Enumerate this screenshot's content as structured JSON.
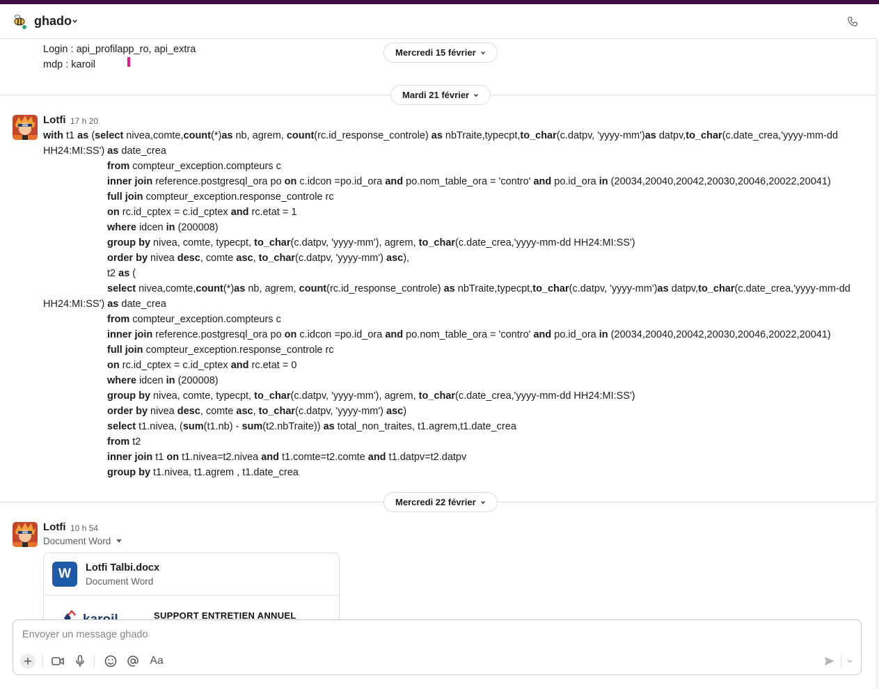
{
  "header": {
    "workspace_name": "ghado"
  },
  "previous_message": {
    "lines": [
      "Login : api_profilapp_ro, api_extra",
      "mdp : karoil"
    ]
  },
  "dates": {
    "d1": "Mercredi 15 février",
    "d2": "Mardi 21 février",
    "d3": "Mercredi 22 février"
  },
  "message1": {
    "author": "Lotfi",
    "time": "17 h 20"
  },
  "message2": {
    "author": "Lotfi",
    "time": "10 h 54",
    "file_subtitle": "Document Word",
    "file": {
      "icon_letter": "W",
      "name": "Lotfi Talbi.docx",
      "type": "Document Word",
      "preview_logo": "karoil",
      "preview_title": "SUPPORT ENTRETIEN ANNUEL"
    }
  },
  "composer": {
    "placeholder": "Envoyer un message ghado",
    "format_label": "Aa"
  },
  "colors": {
    "topbar": "#3f0e40",
    "word_blue": "#1e5aa8",
    "cursor": "#e8198b",
    "online": "#2bac76"
  },
  "icons": [
    "chevron-down-icon",
    "phone-icon",
    "plus-icon",
    "video-icon",
    "microphone-icon",
    "emoji-icon",
    "mention-icon",
    "send-icon"
  ],
  "code_lines": [
    {
      "segments": [
        [
          "b",
          "with"
        ],
        [
          "t",
          " t1 "
        ],
        [
          "b",
          "as"
        ],
        [
          "t",
          " ("
        ],
        [
          "b",
          "select"
        ],
        [
          "t",
          " nivea,comte,"
        ],
        [
          "b",
          "count"
        ],
        [
          "t",
          "(*)"
        ],
        [
          "b",
          "as"
        ],
        [
          "t",
          " nb, agrem, "
        ],
        [
          "b",
          "count"
        ],
        [
          "t",
          "(rc.id_response_controle) "
        ],
        [
          "b",
          "as"
        ],
        [
          "t",
          " nbTraite,typecpt,"
        ],
        [
          "b",
          "to_char"
        ],
        [
          "t",
          "(c.datpv, 'yyyy-mm')"
        ],
        [
          "b",
          "as"
        ],
        [
          "t",
          " datpv,"
        ],
        [
          "b",
          "to_char"
        ],
        [
          "t",
          "(c.date_crea,'yyyy-mm-dd"
        ]
      ]
    },
    {
      "segments": [
        [
          "t",
          "HH24:MI:SS') "
        ],
        [
          "b",
          "as"
        ],
        [
          "t",
          " date_crea"
        ]
      ]
    },
    {
      "indent": true,
      "segments": [
        [
          "b",
          "from"
        ],
        [
          "t",
          " compteur_exception.compteurs c"
        ]
      ]
    },
    {
      "indent": true,
      "segments": [
        [
          "b",
          "inner join"
        ],
        [
          "t",
          " reference.postgresql_ora po "
        ],
        [
          "b",
          "on"
        ],
        [
          "t",
          " c.idcon =po.id_ora "
        ],
        [
          "b",
          "and"
        ],
        [
          "t",
          " po.nom_table_ora = 'contro' "
        ],
        [
          "b",
          "and"
        ],
        [
          "t",
          " po.id_ora "
        ],
        [
          "b",
          "in"
        ],
        [
          "t",
          " (20034,20040,20042,20030,20046,20022,20041)"
        ]
      ]
    },
    {
      "indent": true,
      "segments": [
        [
          "b",
          "full join"
        ],
        [
          "t",
          " compteur_exception.response_controle rc"
        ]
      ]
    },
    {
      "indent": true,
      "segments": [
        [
          "b",
          "on"
        ],
        [
          "t",
          " rc.id_cptex = c.id_cptex "
        ],
        [
          "b",
          "and"
        ],
        [
          "t",
          " rc.etat = 1"
        ]
      ]
    },
    {
      "indent": true,
      "segments": [
        [
          "b",
          "where"
        ],
        [
          "t",
          " idcen "
        ],
        [
          "b",
          "in"
        ],
        [
          "t",
          " (200008)"
        ]
      ]
    },
    {
      "indent": true,
      "segments": [
        [
          "b",
          "group by"
        ],
        [
          "t",
          " nivea, comte, typecpt, "
        ],
        [
          "b",
          "to_char"
        ],
        [
          "t",
          "(c.datpv, 'yyyy-mm'), agrem, "
        ],
        [
          "b",
          "to_char"
        ],
        [
          "t",
          "(c.date_crea,'yyyy-mm-dd HH24:MI:SS')"
        ]
      ]
    },
    {
      "indent": true,
      "segments": [
        [
          "b",
          "order by"
        ],
        [
          "t",
          " nivea "
        ],
        [
          "b",
          "desc"
        ],
        [
          "t",
          ", comte "
        ],
        [
          "b",
          "asc"
        ],
        [
          "t",
          ", "
        ],
        [
          "b",
          "to_char"
        ],
        [
          "t",
          "(c.datpv, 'yyyy-mm') "
        ],
        [
          "b",
          "asc"
        ],
        [
          "t",
          "),"
        ]
      ]
    },
    {
      "indent": true,
      "segments": [
        [
          "t",
          "t2 "
        ],
        [
          "b",
          "as"
        ],
        [
          "t",
          " ("
        ]
      ]
    },
    {
      "indent": true,
      "segments": [
        [
          "b",
          "select"
        ],
        [
          "t",
          " nivea,comte,"
        ],
        [
          "b",
          "count"
        ],
        [
          "t",
          "(*)"
        ],
        [
          "b",
          "as"
        ],
        [
          "t",
          " nb, agrem, "
        ],
        [
          "b",
          "count"
        ],
        [
          "t",
          "(rc.id_response_controle) "
        ],
        [
          "b",
          "as"
        ],
        [
          "t",
          " nbTraite,typecpt,"
        ],
        [
          "b",
          "to_char"
        ],
        [
          "t",
          "(c.datpv, 'yyyy-mm')"
        ],
        [
          "b",
          "as"
        ],
        [
          "t",
          " datpv,"
        ],
        [
          "b",
          "to_char"
        ],
        [
          "t",
          "(c.date_crea,'yyyy-mm-dd"
        ]
      ]
    },
    {
      "segments": [
        [
          "t",
          "HH24:MI:SS') "
        ],
        [
          "b",
          "as"
        ],
        [
          "t",
          " date_crea"
        ]
      ]
    },
    {
      "indent": true,
      "segments": [
        [
          "b",
          "from"
        ],
        [
          "t",
          " compteur_exception.compteurs c"
        ]
      ]
    },
    {
      "indent": true,
      "segments": [
        [
          "b",
          "inner join"
        ],
        [
          "t",
          " reference.postgresql_ora po "
        ],
        [
          "b",
          "on"
        ],
        [
          "t",
          " c.idcon =po.id_ora "
        ],
        [
          "b",
          "and"
        ],
        [
          "t",
          " po.nom_table_ora = 'contro' "
        ],
        [
          "b",
          "and"
        ],
        [
          "t",
          " po.id_ora "
        ],
        [
          "b",
          "in"
        ],
        [
          "t",
          " (20034,20040,20042,20030,20046,20022,20041)"
        ]
      ]
    },
    {
      "indent": true,
      "segments": [
        [
          "b",
          "full join"
        ],
        [
          "t",
          " compteur_exception.response_controle rc"
        ]
      ]
    },
    {
      "indent": true,
      "segments": [
        [
          "b",
          "on"
        ],
        [
          "t",
          " rc.id_cptex = c.id_cptex "
        ],
        [
          "b",
          "and"
        ],
        [
          "t",
          " rc.etat = 0"
        ]
      ]
    },
    {
      "indent": true,
      "segments": [
        [
          "b",
          "where"
        ],
        [
          "t",
          " idcen "
        ],
        [
          "b",
          "in"
        ],
        [
          "t",
          " (200008)"
        ]
      ]
    },
    {
      "indent": true,
      "segments": [
        [
          "b",
          "group by"
        ],
        [
          "t",
          " nivea, comte, typecpt, "
        ],
        [
          "b",
          "to_char"
        ],
        [
          "t",
          "(c.datpv, 'yyyy-mm'), agrem, "
        ],
        [
          "b",
          "to_char"
        ],
        [
          "t",
          "(c.date_crea,'yyyy-mm-dd HH24:MI:SS')"
        ]
      ]
    },
    {
      "indent": true,
      "segments": [
        [
          "b",
          "order by"
        ],
        [
          "t",
          " nivea "
        ],
        [
          "b",
          "desc"
        ],
        [
          "t",
          ", comte "
        ],
        [
          "b",
          "asc"
        ],
        [
          "t",
          ", "
        ],
        [
          "b",
          "to_char"
        ],
        [
          "t",
          "(c.datpv, 'yyyy-mm') "
        ],
        [
          "b",
          "asc"
        ],
        [
          "t",
          ")"
        ]
      ]
    },
    {
      "indent": true,
      "segments": [
        [
          "b",
          "select"
        ],
        [
          "t",
          " t1.nivea, ("
        ],
        [
          "b",
          "sum"
        ],
        [
          "t",
          "(t1.nb) - "
        ],
        [
          "b",
          "sum"
        ],
        [
          "t",
          "(t2.nbTraite)) "
        ],
        [
          "b",
          "as"
        ],
        [
          "t",
          " total_non_traites, t1.agrem,t1.date_crea"
        ]
      ]
    },
    {
      "indent": true,
      "segments": [
        [
          "b",
          "from"
        ],
        [
          "t",
          " t2"
        ]
      ]
    },
    {
      "indent": true,
      "segments": [
        [
          "b",
          "inner join"
        ],
        [
          "t",
          " t1 "
        ],
        [
          "b",
          "on"
        ],
        [
          "t",
          " t1.nivea=t2.nivea "
        ],
        [
          "b",
          "and"
        ],
        [
          "t",
          " t1.comte=t2.comte "
        ],
        [
          "b",
          "and"
        ],
        [
          "t",
          " t1.datpv=t2.datpv"
        ]
      ]
    },
    {
      "indent": true,
      "segments": [
        [
          "b",
          "group by"
        ],
        [
          "t",
          " t1.nivea, t1.agrem , t1.date_crea"
        ]
      ]
    }
  ]
}
